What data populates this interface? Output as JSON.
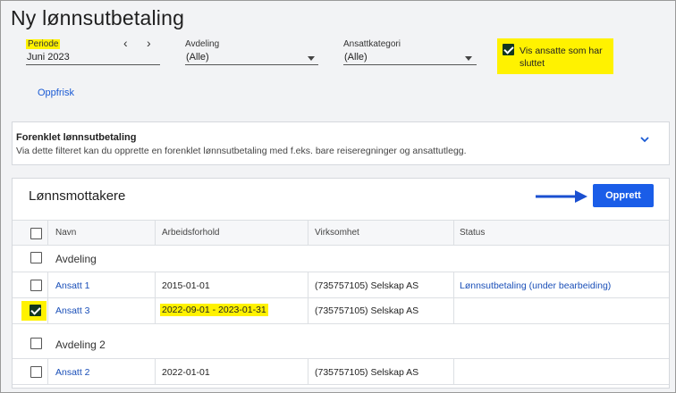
{
  "page_title": "Ny lønnsutbetaling",
  "filters": {
    "periode_label": "Periode",
    "periode_value": "Juni 2023",
    "avdeling_label": "Avdeling",
    "avdeling_value": "(Alle)",
    "ansattkategori_label": "Ansattkategori",
    "ansattkategori_value": "(Alle)",
    "vis_sluttet_label": "Vis ansatte som har sluttet",
    "vis_sluttet_checked": true,
    "refresh_label": "Oppfrisk"
  },
  "simplified": {
    "title": "Forenklet lønnsutbetaling",
    "description": "Via dette filteret kan du opprette en forenklet lønnsutbetaling med f.eks. bare reiseregninger og ansattutlegg."
  },
  "recipients": {
    "title": "Lønnsmottakere",
    "create_label": "Opprett",
    "columns": [
      "Navn",
      "Arbeidsforhold",
      "Virksomhet",
      "Status"
    ],
    "groups": [
      {
        "name": "Avdeling",
        "rows": [
          {
            "name": "Ansatt 1",
            "arbeidsforhold": "2015-01-01",
            "virksomhet": "(735757105) Selskap AS",
            "status": "Lønnsutbetaling (under bearbeiding)",
            "checked": false
          },
          {
            "name": "Ansatt 3",
            "arbeidsforhold": "2022-09-01 - 2023-01-31",
            "virksomhet": "(735757105) Selskap AS",
            "status": "",
            "checked": true
          }
        ]
      },
      {
        "name": "Avdeling 2",
        "rows": [
          {
            "name": "Ansatt 2",
            "arbeidsforhold": "2022-01-01",
            "virksomhet": "(735757105) Selskap AS",
            "status": "",
            "checked": false
          }
        ]
      }
    ]
  },
  "colors": {
    "accent": "#1a5de8",
    "highlight": "#fff200",
    "checkbox_checked": "#13371f"
  }
}
